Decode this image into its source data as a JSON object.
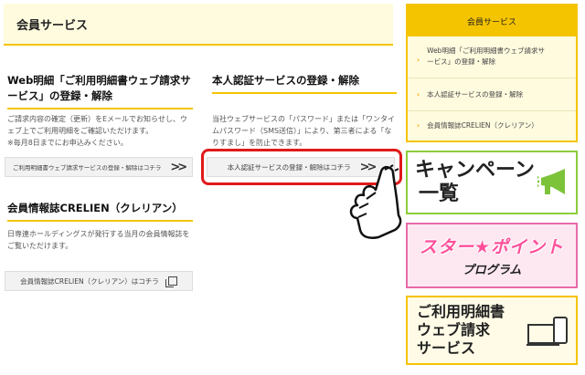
{
  "main_header": {
    "title": "会員サービス"
  },
  "sections": {
    "web_meisai": {
      "title_line1": "Web明細「ご利用明細書ウェブ請求サ",
      "title_line2": "ービス」の登録・解除",
      "desc_lines": [
        "ご請求内容の確定（更新）をEメールでお知らせし、ウ",
        "ェブ上でご利用明細をご確認いただけます。",
        "※毎月8日までにお申込みください。"
      ],
      "button": "ご利用明細書ウェブ請求サービスの登録・解除はコチラ",
      "button_icon": "double-chevron-right-icon"
    },
    "honnin": {
      "title": "本人認証サービスの登録・解除",
      "desc_lines": [
        "当社ウェブサービスの「パスワード」または「ワンタイ",
        "ムパスワード（SMS送信）」により、第三者による「な",
        "りすまし」を防止できます。"
      ],
      "button": "本人認証サービスの登録・解除はコチラ",
      "button_icon": "double-chevron-right-icon"
    },
    "crelien": {
      "title": "会員情報誌CRELIEN（クレリアン）",
      "desc_lines": [
        "日専連ホールディングスが発行する当月の会員情報誌を",
        "ご覧いただけます。"
      ],
      "button": "会員情報誌CRELIEN（クレリアン）はコチラ",
      "button_icon": "external-window-icon"
    }
  },
  "sidebar": {
    "title": "会員サービス",
    "items": [
      {
        "line1": "Web明細「ご利用明細書ウェブ請求サ",
        "line2": "ービス」の登録・解除"
      },
      {
        "line1": "本人認証サービスの登録・解除",
        "line2": ""
      },
      {
        "line1": "会員情報誌CRELIEN（クレリアン）",
        "line2": ""
      }
    ]
  },
  "banners": {
    "campaign": {
      "line1": "キャンペーン",
      "line2": "一覧",
      "icon": "megaphone-icon"
    },
    "star_point": {
      "line1": "スター★ポイント",
      "line2": "プログラム"
    },
    "web_seikyu": {
      "line1": "ご利用明細書",
      "line2": "ウェブ請求",
      "line3": "サービス",
      "icon": "laptop-phone-icon"
    }
  },
  "colors": {
    "accent": "#f5c400",
    "highlight": "#e01a1a",
    "campaign_border": "#8ccd3a",
    "star_pink": "#ff4f9a"
  }
}
